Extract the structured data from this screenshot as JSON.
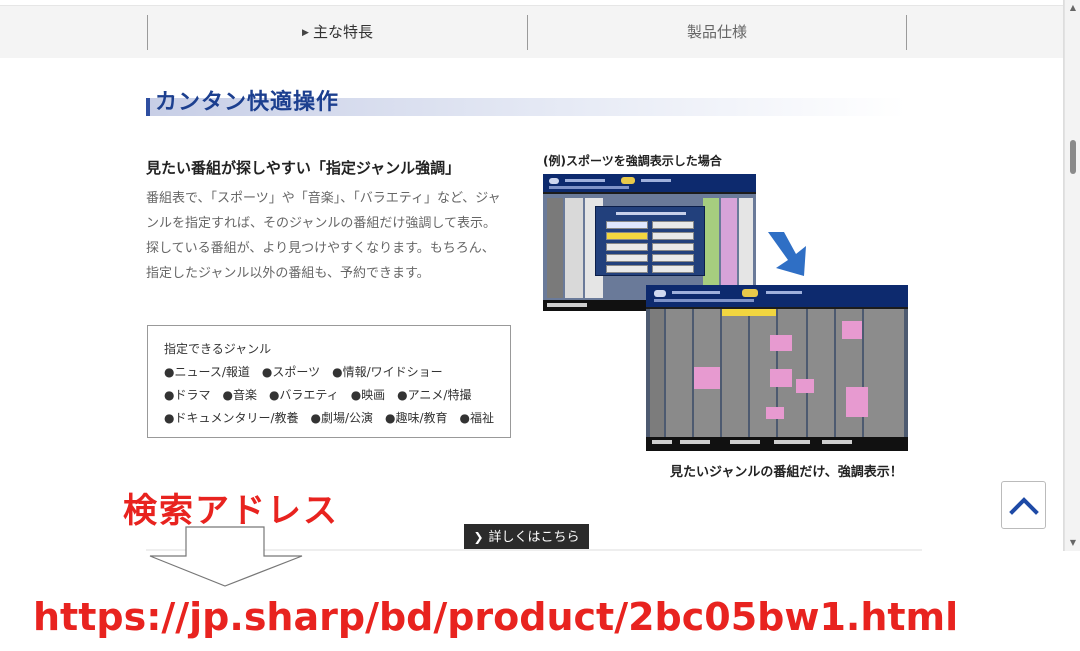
{
  "tabs": [
    {
      "label": "主な特長",
      "active": true
    },
    {
      "label": "製品仕様",
      "active": false
    }
  ],
  "section": {
    "title": "カンタン快適操作",
    "subtitle": "見たい番組が探しやすい「指定ジャンル強調」",
    "body": "番組表で、「スポーツ」や「音楽」、「バラエティ」など、ジャンルを指定すれば、そのジャンルの番組だけ強調して表示。探している番組が、より見つけやすくなります。もちろん、指定したジャンル以外の番組も、予約できます。"
  },
  "genres": {
    "title": "指定できるジャンル",
    "rows": [
      "●ニュース/報道　●スポーツ　●情報/ワイドショー",
      "●ドラマ　●音楽　●バラエティ　●映画　●アニメ/特撮",
      "●ドキュメンタリー/教養　●劇場/公演　●趣味/教育　●福祉"
    ]
  },
  "example": {
    "caption": "(例)スポーツを強調表示した場合",
    "after_caption": "見たいジャンルの番組だけ、強調表示！"
  },
  "detail_button": {
    "label": "詳しくはこちら"
  },
  "annotation": {
    "title": "検索アドレス",
    "url": "https://jp.sharp/bd/product/2bc05bw1.html"
  },
  "icons": {
    "tab_caret": "caret-right-icon",
    "detail_chevron": "chevron-right-icon",
    "back_to_top": "chevron-up-icon",
    "transition_arrow": "arrow-down-right-icon"
  },
  "colors": {
    "section_title": "#1c3f8f",
    "annotation_red": "#e8231f",
    "highlight_yellow": "#f2d640",
    "highlight_pink": "#e79ad0"
  }
}
